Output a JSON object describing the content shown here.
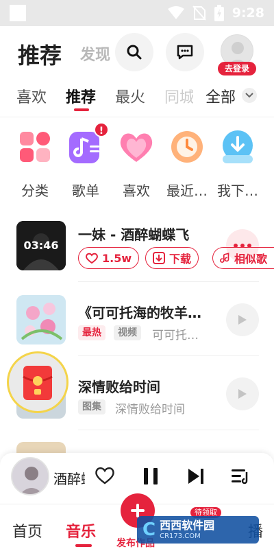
{
  "status_bar": {
    "time": "9:28"
  },
  "header": {
    "title": "推荐",
    "subtitle": "发现",
    "login_badge": "去登录"
  },
  "tabs": [
    {
      "label": "喜欢"
    },
    {
      "label": "推荐"
    },
    {
      "label": "最火"
    },
    {
      "label": "同城"
    },
    {
      "label": "全部"
    }
  ],
  "categories": [
    {
      "label": "分类",
      "icon": "category-icon"
    },
    {
      "label": "歌单",
      "icon": "playlist-icon",
      "badge": "!"
    },
    {
      "label": "喜欢",
      "icon": "heart-icon"
    },
    {
      "label": "最近…",
      "icon": "recent-icon"
    },
    {
      "label": "我下…",
      "icon": "download-icon"
    }
  ],
  "songs": [
    {
      "title": "一妹 - 酒醉蝴蝶飞",
      "duration": "03:46",
      "actions": [
        {
          "label": "1.5w",
          "icon": "heart-outline-icon"
        },
        {
          "label": "下载",
          "icon": "download-icon"
        },
        {
          "label": "相似歌",
          "icon": "music-note-icon"
        }
      ]
    },
    {
      "title": "《可可托海的牧羊…",
      "tags": [
        "最热",
        "视频"
      ],
      "subtitle": "可可托…"
    },
    {
      "title": "深情败给时间",
      "tags": [
        "图集"
      ],
      "subtitle": "深情败给时间"
    }
  ],
  "player": {
    "title": "酒醉蝴蝶飞"
  },
  "bottom_nav": {
    "home": "首页",
    "music": "音乐",
    "publish": "发布作品",
    "live_badge": "待领取",
    "last": "播"
  },
  "watermark": {
    "logo": "C",
    "title": "西西软件园",
    "url": "CR173.COM"
  },
  "colors": {
    "accent": "#e5233d"
  }
}
